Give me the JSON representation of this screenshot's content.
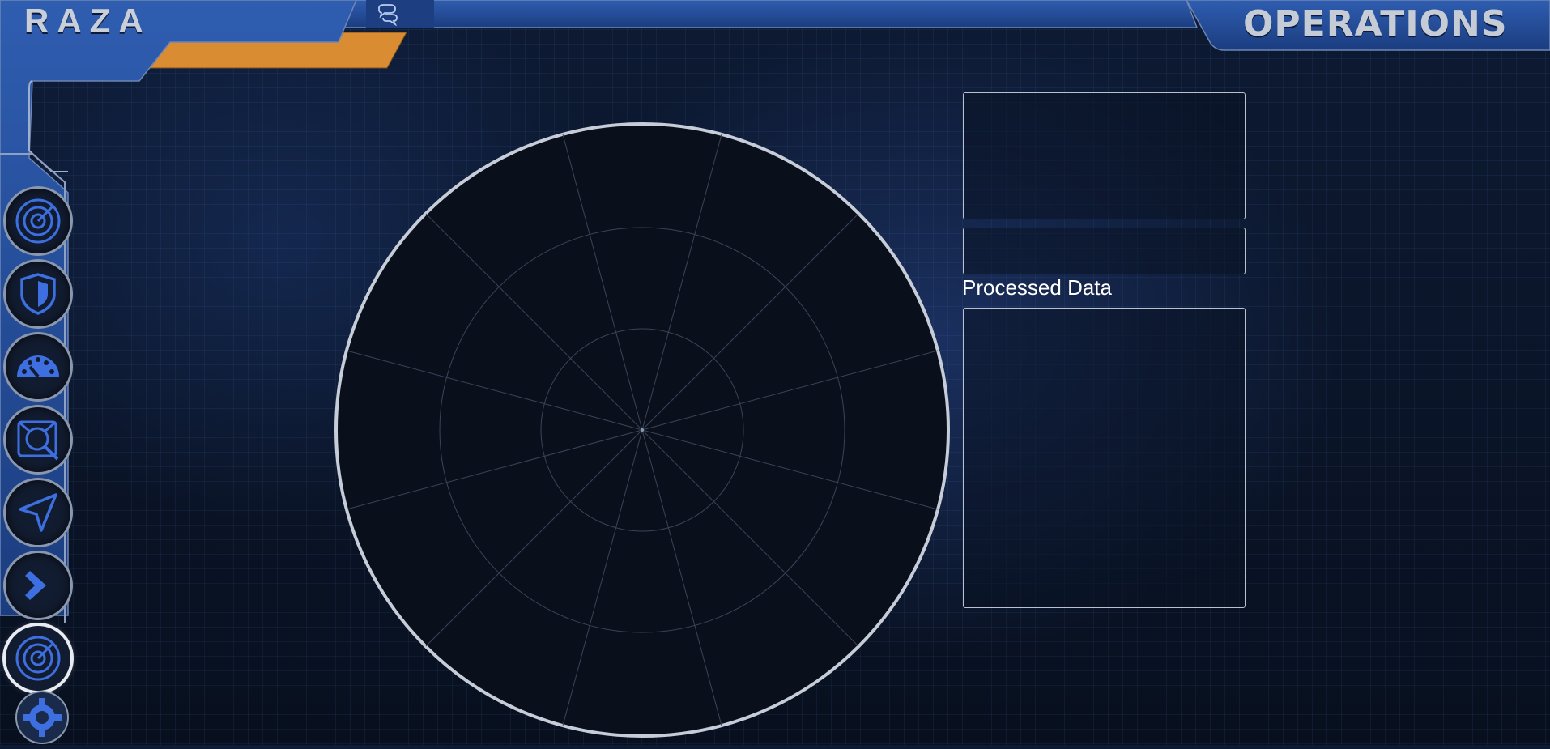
{
  "app": {
    "brand": "RAZA",
    "section_title": "OPERATIONS"
  },
  "header": {
    "chat_icon": "chat-bubbles-icon"
  },
  "sidebar": {
    "items": [
      {
        "id": "radar",
        "icon": "radar-icon"
      },
      {
        "id": "shield",
        "icon": "shield-icon"
      },
      {
        "id": "dashboard",
        "icon": "speedometer-icon"
      },
      {
        "id": "inspect",
        "icon": "radar-search-icon"
      },
      {
        "id": "navigate",
        "icon": "navigation-arrow-icon"
      },
      {
        "id": "forward",
        "icon": "chevron-right-icon"
      },
      {
        "id": "operations",
        "icon": "radar-icon",
        "active": true
      },
      {
        "id": "settings",
        "icon": "gear-icon"
      }
    ]
  },
  "main": {
    "processed_data_label": "Processed Data"
  },
  "colors": {
    "accent_orange": "#d98c32",
    "frame_blue": "#2a54a0",
    "icon_blue": "#3d6fe0"
  }
}
